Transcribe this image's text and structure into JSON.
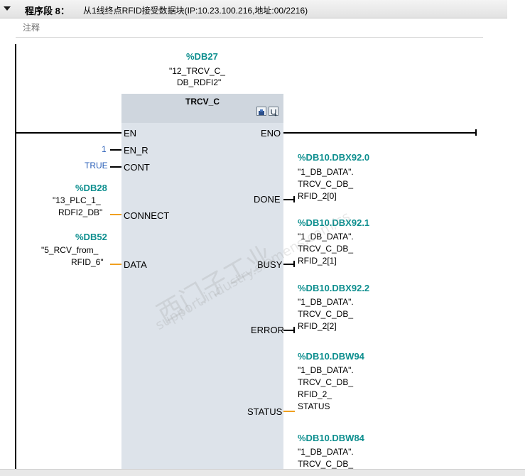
{
  "network": {
    "title": "程序段 8：",
    "description": "从1线终点RFID接受数据块(IP:10.23.100.216,地址:00/2216)",
    "comment": "注释"
  },
  "instance": {
    "address": "%DB27",
    "name_lines": [
      "\"12_TRCV_C_",
      "DB_RDFI2\""
    ]
  },
  "block": {
    "name": "TRCV_C",
    "icons": [
      "block-info-icon",
      "block-diagnostics-icon"
    ]
  },
  "inputs": {
    "en": {
      "pin": "EN"
    },
    "en_r": {
      "pin": "EN_R",
      "value": "1"
    },
    "cont": {
      "pin": "CONT",
      "value": "TRUE"
    },
    "connect": {
      "pin": "CONNECT",
      "address": "%DB28",
      "name_lines": [
        "\"13_PLC_1_",
        "RDFI2_DB\""
      ]
    },
    "data": {
      "pin": "DATA",
      "address": "%DB52",
      "name_lines": [
        "\"5_RCV_from_",
        "RFID_6\""
      ]
    }
  },
  "outputs": {
    "eno": {
      "pin": "ENO"
    },
    "done": {
      "pin": "DONE",
      "address": "%DB10.DBX92.0",
      "name_lines": [
        "\"1_DB_DATA\".",
        "TRCV_C_DB_",
        "RFID_2[0]"
      ]
    },
    "busy": {
      "pin": "BUSY",
      "address": "%DB10.DBX92.1",
      "name_lines": [
        "\"1_DB_DATA\".",
        "TRCV_C_DB_",
        "RFID_2[1]"
      ]
    },
    "error": {
      "pin": "ERROR",
      "address": "%DB10.DBX92.2",
      "name_lines": [
        "\"1_DB_DATA\".",
        "TRCV_C_DB_",
        "RFID_2[2]"
      ]
    },
    "status": {
      "pin": "STATUS",
      "address": "%DB10.DBW94",
      "name_lines": [
        "\"1_DB_DATA\".",
        "TRCV_C_DB_",
        "RFID_2_",
        "STATUS"
      ]
    },
    "next": {
      "address": "%DB10.DBW84",
      "name_lines": [
        "\"1_DB_DATA\".",
        "TRCV_C_DB_"
      ]
    }
  },
  "watermark": {
    "line1": "西门子工业",
    "line2": "support.industry.siemens.com/cs"
  },
  "colors": {
    "operand_address": "#0e8f8f",
    "constant_value": "#2a5fb8",
    "word_connection": "#f0a020",
    "block_body": "#dde3ea"
  }
}
